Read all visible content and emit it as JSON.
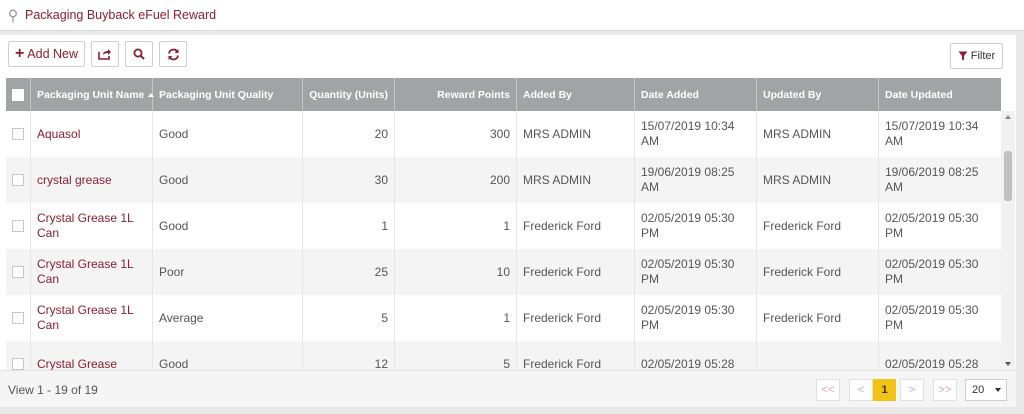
{
  "header": {
    "title": "Packaging Buyback eFuel Reward",
    "icon": "map-pin-icon"
  },
  "toolbar": {
    "add_label": "Add New",
    "filter_label": "Filter",
    "icons": [
      "plus-icon",
      "export-icon",
      "search-icon",
      "refresh-icon",
      "filter-icon"
    ]
  },
  "table": {
    "columns": [
      "Packaging Unit Name",
      "Packaging Unit Quality",
      "Quantity (Units)",
      "Reward Points",
      "Added By",
      "Date Added",
      "Updated By",
      "Date Updated"
    ],
    "rows": [
      {
        "name": "Aquasol",
        "quality": "Good",
        "quantity": "20",
        "points": "300",
        "added_by": "MRS ADMIN",
        "date_added": "15/07/2019 10:34 AM",
        "updated_by": "MRS ADMIN",
        "date_updated": "15/07/2019 10:34 AM"
      },
      {
        "name": "crystal grease",
        "quality": "Good",
        "quantity": "30",
        "points": "200",
        "added_by": "MRS ADMIN",
        "date_added": "19/06/2019 08:25 AM",
        "updated_by": "MRS ADMIN",
        "date_updated": "19/06/2019 08:25 AM"
      },
      {
        "name": "Crystal Grease 1L Can",
        "quality": "Good",
        "quantity": "1",
        "points": "1",
        "added_by": "Frederick Ford",
        "date_added": "02/05/2019 05:30 PM",
        "updated_by": "Frederick Ford",
        "date_updated": "02/05/2019 05:30 PM"
      },
      {
        "name": "Crystal Grease 1L Can",
        "quality": "Poor",
        "quantity": "25",
        "points": "10",
        "added_by": "Frederick Ford",
        "date_added": "02/05/2019 05:30 PM",
        "updated_by": "Frederick Ford",
        "date_updated": "02/05/2019 05:30 PM"
      },
      {
        "name": "Crystal Grease 1L Can",
        "quality": "Average",
        "quantity": "5",
        "points": "1",
        "added_by": "Frederick Ford",
        "date_added": "02/05/2019 05:30 PM",
        "updated_by": "Frederick Ford",
        "date_updated": "02/05/2019 05:30 PM"
      },
      {
        "name": "Crystal Grease",
        "quality": "Good",
        "quantity": "12",
        "points": "5",
        "added_by": "Frederick Ford",
        "date_added": "02/05/2019 05:28",
        "updated_by": "",
        "date_updated": "02/05/2019 05:28"
      }
    ]
  },
  "footer": {
    "view_text": "View 1 - 19 of 19",
    "pager": {
      "first": "<<",
      "prev": "<",
      "current": "1",
      "next": ">",
      "last": ">>"
    },
    "page_size": "20"
  },
  "colors": {
    "accent": "#8b1e2f",
    "header_bg": "#a2a3a5",
    "current_page": "#f2c314"
  }
}
